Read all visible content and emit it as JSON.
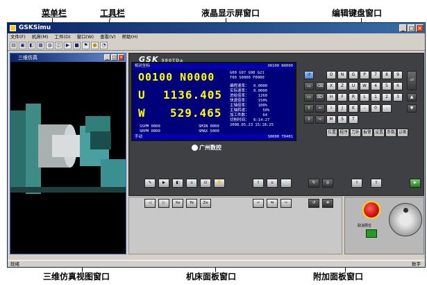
{
  "callouts": {
    "menubar": "菜单栏",
    "toolbar": "工具栏",
    "lcd_window": "液晶显示屏窗口",
    "keyboard_window": "编辑键盘窗口",
    "sim_window": "三维仿真视图窗口",
    "machine_panel": "机床面板窗口",
    "addon_panel": "附加面板窗口"
  },
  "app": {
    "title": "GSKSimu",
    "menu": [
      "文件(F)",
      "机床(M)",
      "工件(D)",
      "窗口(W)",
      "查看(V)",
      "帮助(H)"
    ],
    "toolbar_icons": [
      "open-icon",
      "save-icon",
      "view-icon",
      "grid-icon",
      "zoom-icon",
      "fit-icon",
      "play-icon",
      "stop-icon",
      "flag-icon",
      "coin-icon",
      "gauge-icon"
    ],
    "statusbar_left": "就绪",
    "statusbar_right": "数字"
  },
  "sim": {
    "title": "三维仿真"
  },
  "cnc": {
    "brand": "GSK",
    "model": "980TDa",
    "lcd": {
      "header_left": "相对坐标",
      "header_right": "O0100 N0000",
      "program": "O0100  N0000",
      "u_label": "U",
      "u_value": "1136.405",
      "w_label": "W",
      "w_value": "529.465",
      "modal_line1": "G00 G97 G98 G21",
      "modal_line2": "T00 S0000 F0000",
      "info_lines": "编程速率：  0.0000\n实际速率：  0.0000\n进给倍率：    1260\n快速倍率：    150%\n主轴倍率：    100%\n主轴转速：      50%\n加工件数：      64\n切削时间：  6:14:27\n2008.05.23 15:18:25",
      "sspm": "SSPM 0000",
      "sspm2": "SRPM 0000",
      "smin": "SMIN 0000",
      "smax": "SMAX 5000",
      "footer_left": "手动",
      "footer_right": "S0000 T0401"
    },
    "logo_text": "广州数控",
    "keys": [
      "O",
      "N",
      "G",
      "P",
      "7",
      "8",
      "9",
      "X",
      "Z",
      "U",
      "W",
      "4",
      "5",
      "6",
      "H",
      "F",
      "R",
      "L",
      "1",
      "2",
      "3",
      "I",
      "J",
      "K",
      "-",
      "0",
      ".",
      "M",
      "S",
      "T"
    ],
    "page_keys": [
      "位置",
      "程序",
      "刀补",
      "报警",
      "设置",
      "参数",
      "诊断"
    ]
  },
  "addon": {
    "reset_label": "取消限位"
  }
}
